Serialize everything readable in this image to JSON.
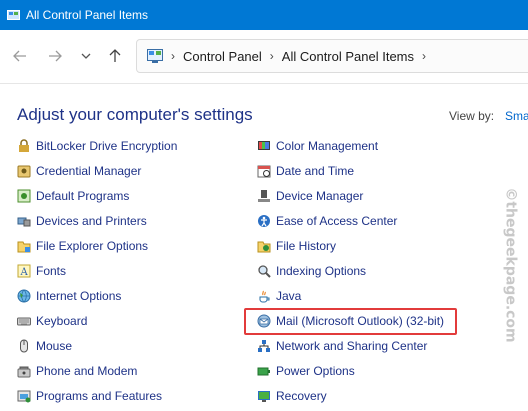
{
  "window": {
    "title": "All Control Panel Items"
  },
  "address": {
    "crumbs": [
      "Control Panel",
      "All Control Panel Items"
    ]
  },
  "header": {
    "title": "Adjust your computer's settings",
    "view_by_label": "View by:",
    "view_by_value": "Sma"
  },
  "left_items": [
    {
      "label": "BitLocker Drive Encryption",
      "icon": "bitlocker-icon"
    },
    {
      "label": "Credential Manager",
      "icon": "credential-manager-icon"
    },
    {
      "label": "Default Programs",
      "icon": "default-programs-icon"
    },
    {
      "label": "Devices and Printers",
      "icon": "devices-printers-icon"
    },
    {
      "label": "File Explorer Options",
      "icon": "folder-options-icon"
    },
    {
      "label": "Fonts",
      "icon": "fonts-icon"
    },
    {
      "label": "Internet Options",
      "icon": "internet-options-icon"
    },
    {
      "label": "Keyboard",
      "icon": "keyboard-icon"
    },
    {
      "label": "Mouse",
      "icon": "mouse-icon"
    },
    {
      "label": "Phone and Modem",
      "icon": "phone-modem-icon"
    },
    {
      "label": "Programs and Features",
      "icon": "programs-features-icon"
    }
  ],
  "right_items": [
    {
      "label": "Color Management",
      "icon": "color-management-icon"
    },
    {
      "label": "Date and Time",
      "icon": "date-time-icon"
    },
    {
      "label": "Device Manager",
      "icon": "device-manager-icon"
    },
    {
      "label": "Ease of Access Center",
      "icon": "ease-of-access-icon"
    },
    {
      "label": "File History",
      "icon": "file-history-icon"
    },
    {
      "label": "Indexing Options",
      "icon": "indexing-options-icon"
    },
    {
      "label": "Java",
      "icon": "java-icon"
    },
    {
      "label": "Mail (Microsoft Outlook) (32-bit)",
      "icon": "mail-icon"
    },
    {
      "label": "Network and Sharing Center",
      "icon": "network-icon"
    },
    {
      "label": "Power Options",
      "icon": "power-options-icon"
    },
    {
      "label": "Recovery",
      "icon": "recovery-icon"
    }
  ],
  "watermark": "©thegeekpage.com",
  "colors": {
    "titlebar": "#0078d4",
    "link": "#1e3287",
    "highlight": "#e23b3b"
  }
}
